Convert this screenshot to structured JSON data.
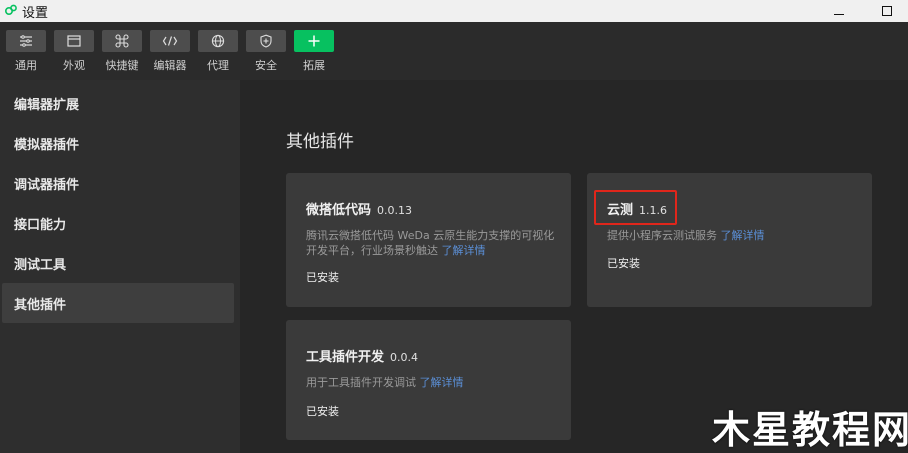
{
  "window": {
    "title": "设置"
  },
  "toolbar": {
    "items": [
      {
        "label": "通用",
        "icon": "sliders-icon"
      },
      {
        "label": "外观",
        "icon": "window-layout-icon"
      },
      {
        "label": "快捷键",
        "icon": "command-key-icon"
      },
      {
        "label": "编辑器",
        "icon": "code-brackets-icon"
      },
      {
        "label": "代理",
        "icon": "globe-icon"
      },
      {
        "label": "安全",
        "icon": "shield-icon"
      },
      {
        "label": "拓展",
        "icon": "plus-icon"
      }
    ],
    "accent": "#07c160"
  },
  "sidebar": {
    "items": [
      {
        "label": "编辑器扩展"
      },
      {
        "label": "模拟器插件"
      },
      {
        "label": "调试器插件"
      },
      {
        "label": "接口能力"
      },
      {
        "label": "测试工具"
      },
      {
        "label": "其他插件",
        "active": true
      }
    ]
  },
  "main": {
    "section_title": "其他插件",
    "plugins": [
      {
        "name": "微搭低代码",
        "version": "0.0.13",
        "desc_line1": "腾讯云微搭低代码 WeDa 云原生能力支撑的可视化",
        "desc_line2": "开发平台，行业场景秒触达",
        "link": "了解详情",
        "status": "已安装"
      },
      {
        "name": "云测",
        "version": "1.1.6",
        "desc_line1": "提供小程序云测试服务",
        "link": "了解详情",
        "status": "已安装",
        "highlighted": true
      },
      {
        "name": "工具插件开发",
        "version": "0.0.4",
        "desc_line1": "用于工具插件开发调试",
        "link": "了解详情",
        "status": "已安装"
      }
    ],
    "highlight_color": "#e0261b",
    "link_color": "#5b8fd6"
  },
  "watermark": {
    "text": "木星教程网"
  }
}
